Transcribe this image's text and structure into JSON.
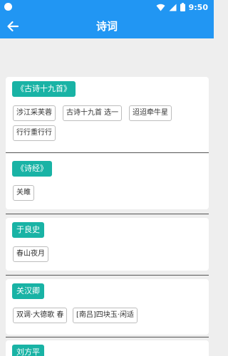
{
  "status_bar": {
    "time": "9:50"
  },
  "app_bar": {
    "title": "诗词"
  },
  "groups": [
    {
      "author": "《古诗十九首》",
      "poems": [
        "涉江采芙蓉",
        "古诗十九首 选一",
        "迢迢牵牛星",
        "行行重行行"
      ]
    },
    {
      "author": "《诗经》",
      "poems": [
        "关雎"
      ]
    },
    {
      "author": "于良史",
      "poems": [
        "春山夜月"
      ]
    },
    {
      "author": "关汉卿",
      "poems": [
        "双调·大德歌 春",
        "[南吕]四块玉·闲适"
      ]
    },
    {
      "author": "刘方平",
      "poems": []
    }
  ]
}
